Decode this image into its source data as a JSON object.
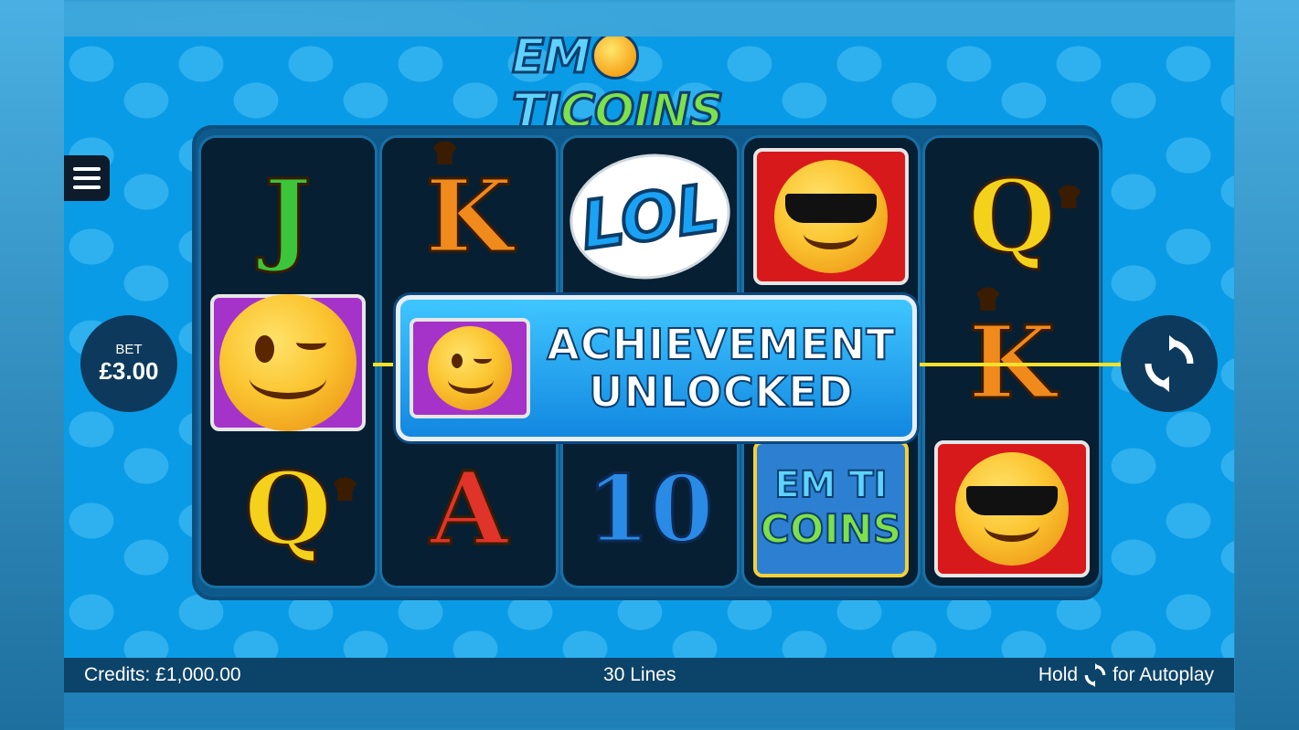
{
  "logo": {
    "part1": "EM",
    "part2": "TI",
    "part3": "COINS"
  },
  "reels": [
    [
      {
        "type": "letter",
        "text": "J",
        "cls": "j"
      },
      {
        "type": "face",
        "bg": "purple",
        "face": "wink"
      },
      {
        "type": "letter",
        "text": "Q",
        "cls": "q",
        "crown": true
      }
    ],
    [
      {
        "type": "letter",
        "text": "K",
        "cls": "k",
        "crown": true
      },
      {
        "type": "hidden"
      },
      {
        "type": "letter",
        "text": "A",
        "cls": "a"
      }
    ],
    [
      {
        "type": "lol",
        "text": "LOL"
      },
      {
        "type": "hidden"
      },
      {
        "type": "letter",
        "text": "10",
        "cls": "ten"
      }
    ],
    [
      {
        "type": "face",
        "bg": "red",
        "face": "cool"
      },
      {
        "type": "hidden"
      },
      {
        "type": "emoticoins",
        "top": "EM TI",
        "bottom": "COINS"
      }
    ],
    [
      {
        "type": "letter",
        "text": "Q",
        "cls": "q",
        "crown": true
      },
      {
        "type": "letter",
        "text": "K",
        "cls": "k",
        "crown": true
      },
      {
        "type": "face",
        "bg": "red",
        "face": "cool"
      }
    ]
  ],
  "achievement": {
    "line1": "ACHIEVEMENT",
    "line2": "UNLOCKED"
  },
  "bet": {
    "label": "BET",
    "value": "£3.00"
  },
  "status": {
    "credits": "Credits: £1,000.00",
    "lines": "30 Lines",
    "hold": "Hold",
    "autoplay": "for Autoplay"
  }
}
